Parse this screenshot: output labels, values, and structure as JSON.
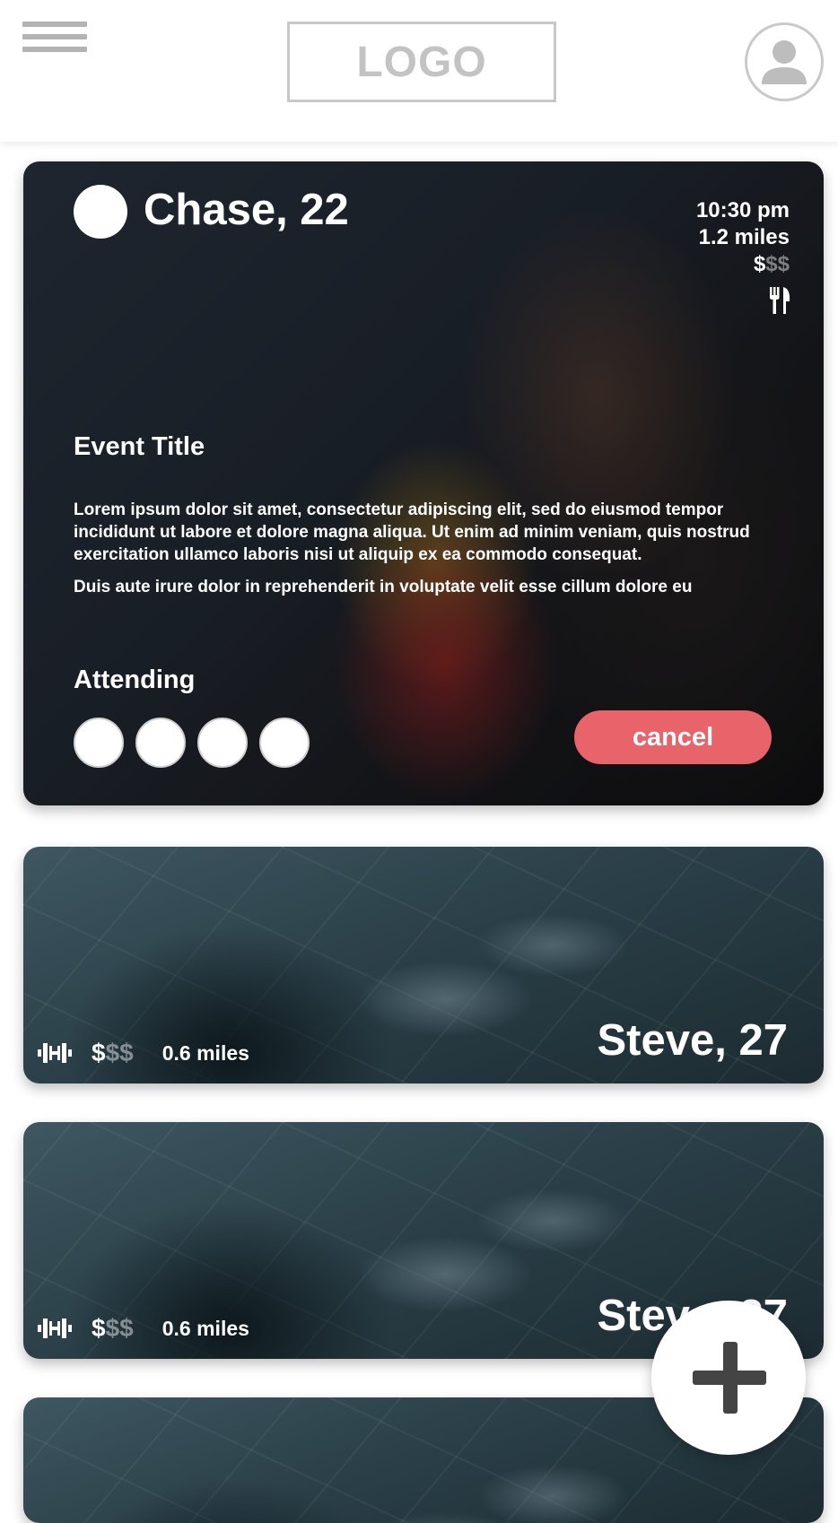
{
  "header": {
    "logo_text": "LOGO",
    "menu_icon": "hamburger-menu-icon",
    "profile_icon": "user-avatar-icon"
  },
  "featured_event": {
    "host": "Chase, 22",
    "time": "10:30 pm",
    "distance": "1.2 miles",
    "price_active": "$",
    "price_inactive": "$$",
    "category_icon": "fork-knife-icon",
    "title": "Event Title",
    "description": [
      "Lorem ipsum dolor sit amet, consectetur adipiscing elit, sed do eiusmod tempor incididunt ut labore et dolore magna aliqua. Ut enim ad minim veniam, quis nostrud exercitation ullamco laboris nisi ut aliquip ex ea commodo consequat.",
      "Duis aute irure dolor in reprehenderit in voluptate velit esse cillum dolore eu"
    ],
    "attending_label": "Attending",
    "attendee_count": 4,
    "cancel_label": "cancel"
  },
  "events": [
    {
      "host": "Steve, 27",
      "price_active": "$",
      "price_inactive": "$$",
      "distance": "0.6 miles",
      "category_icon": "dumbbell-icon"
    },
    {
      "host": "Steve, 27",
      "price_active": "$",
      "price_inactive": "$$",
      "distance": "0.6 miles",
      "category_icon": "dumbbell-icon"
    }
  ],
  "fab": {
    "icon": "plus-icon"
  },
  "colors": {
    "accent": "#e8636a",
    "logo_gray": "#c3c3c3"
  }
}
